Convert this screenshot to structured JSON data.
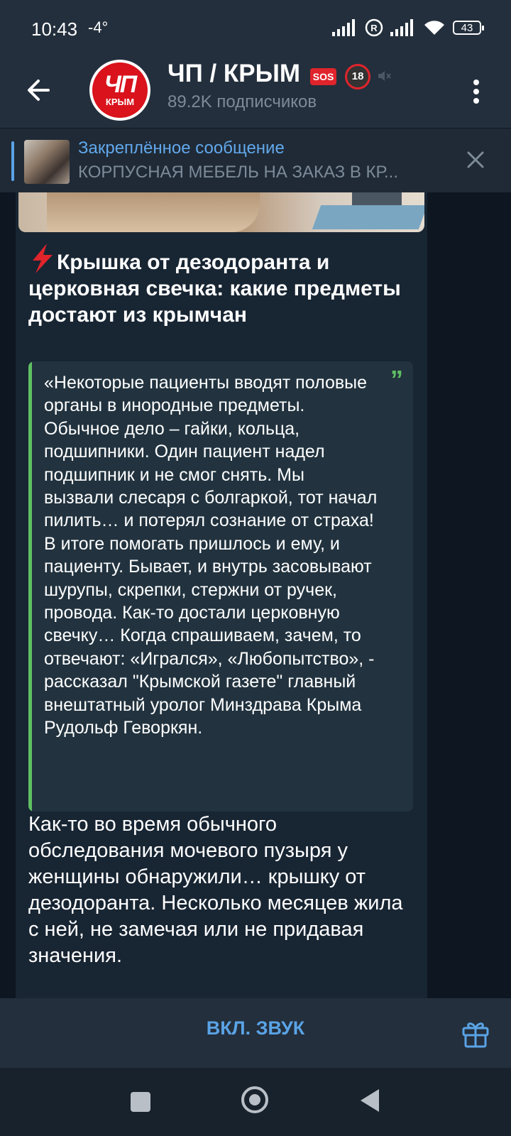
{
  "status_bar": {
    "time": "10:43",
    "temperature": "-4°",
    "battery": "43"
  },
  "header": {
    "avatar_big": "ЧП",
    "avatar_small": "КРЫМ",
    "title": "ЧП / КРЫМ",
    "sos_badge": "SOS",
    "age_badge": "18",
    "subscribers": "89.2K подписчиков"
  },
  "pinned": {
    "title": "Закреплённое сообщение",
    "text": "КОРПУСНАЯ МЕБЕЛЬ НА ЗАКАЗ В КР..."
  },
  "message": {
    "headline": "Крышка от дезодоранта и церковная свечка: какие предметы достают из крымчан",
    "quote_mark": "”",
    "quote": "«Некоторые пациенты вводят половые органы в инородные предметы. Обычное дело – гайки, кольца, подшипники. Один пациент надел подшипник и не смог снять. Мы вызвали слесаря с болгаркой, тот начал пилить… и потерял сознание от страха! В итоге помогать пришлось и ему, и пациенту. Бывает, и внутрь засовывают шурупы, скрепки, стержни от ручек, провода. Как-то достали церковную свечку… Когда спрашиваем, зачем, то отвечают: «Игрался», «Любопытство», - рассказал \"Крымской газете\" главный внештатный уролог Минздрава Крыма Рудольф Геворкян.",
    "body": "Как-то во время обычного обследования мочевого пузыря у женщины обнаружили… крышку от дезодоранта. Несколько месяцев жила с ней, не замечая или не придавая значения."
  },
  "bottom_bar": {
    "unmute_label": "ВКЛ. ЗВУК"
  },
  "colors": {
    "accent": "#5aa3e6",
    "quote_accent": "#5fbf63",
    "bubble": "#182533",
    "header": "#232f3c"
  },
  "icons": [
    "back-arrow-icon",
    "mute-icon",
    "more-vert-icon",
    "close-icon",
    "lightning-icon",
    "gift-icon",
    "signal-icon",
    "wifi-icon",
    "battery-icon"
  ]
}
